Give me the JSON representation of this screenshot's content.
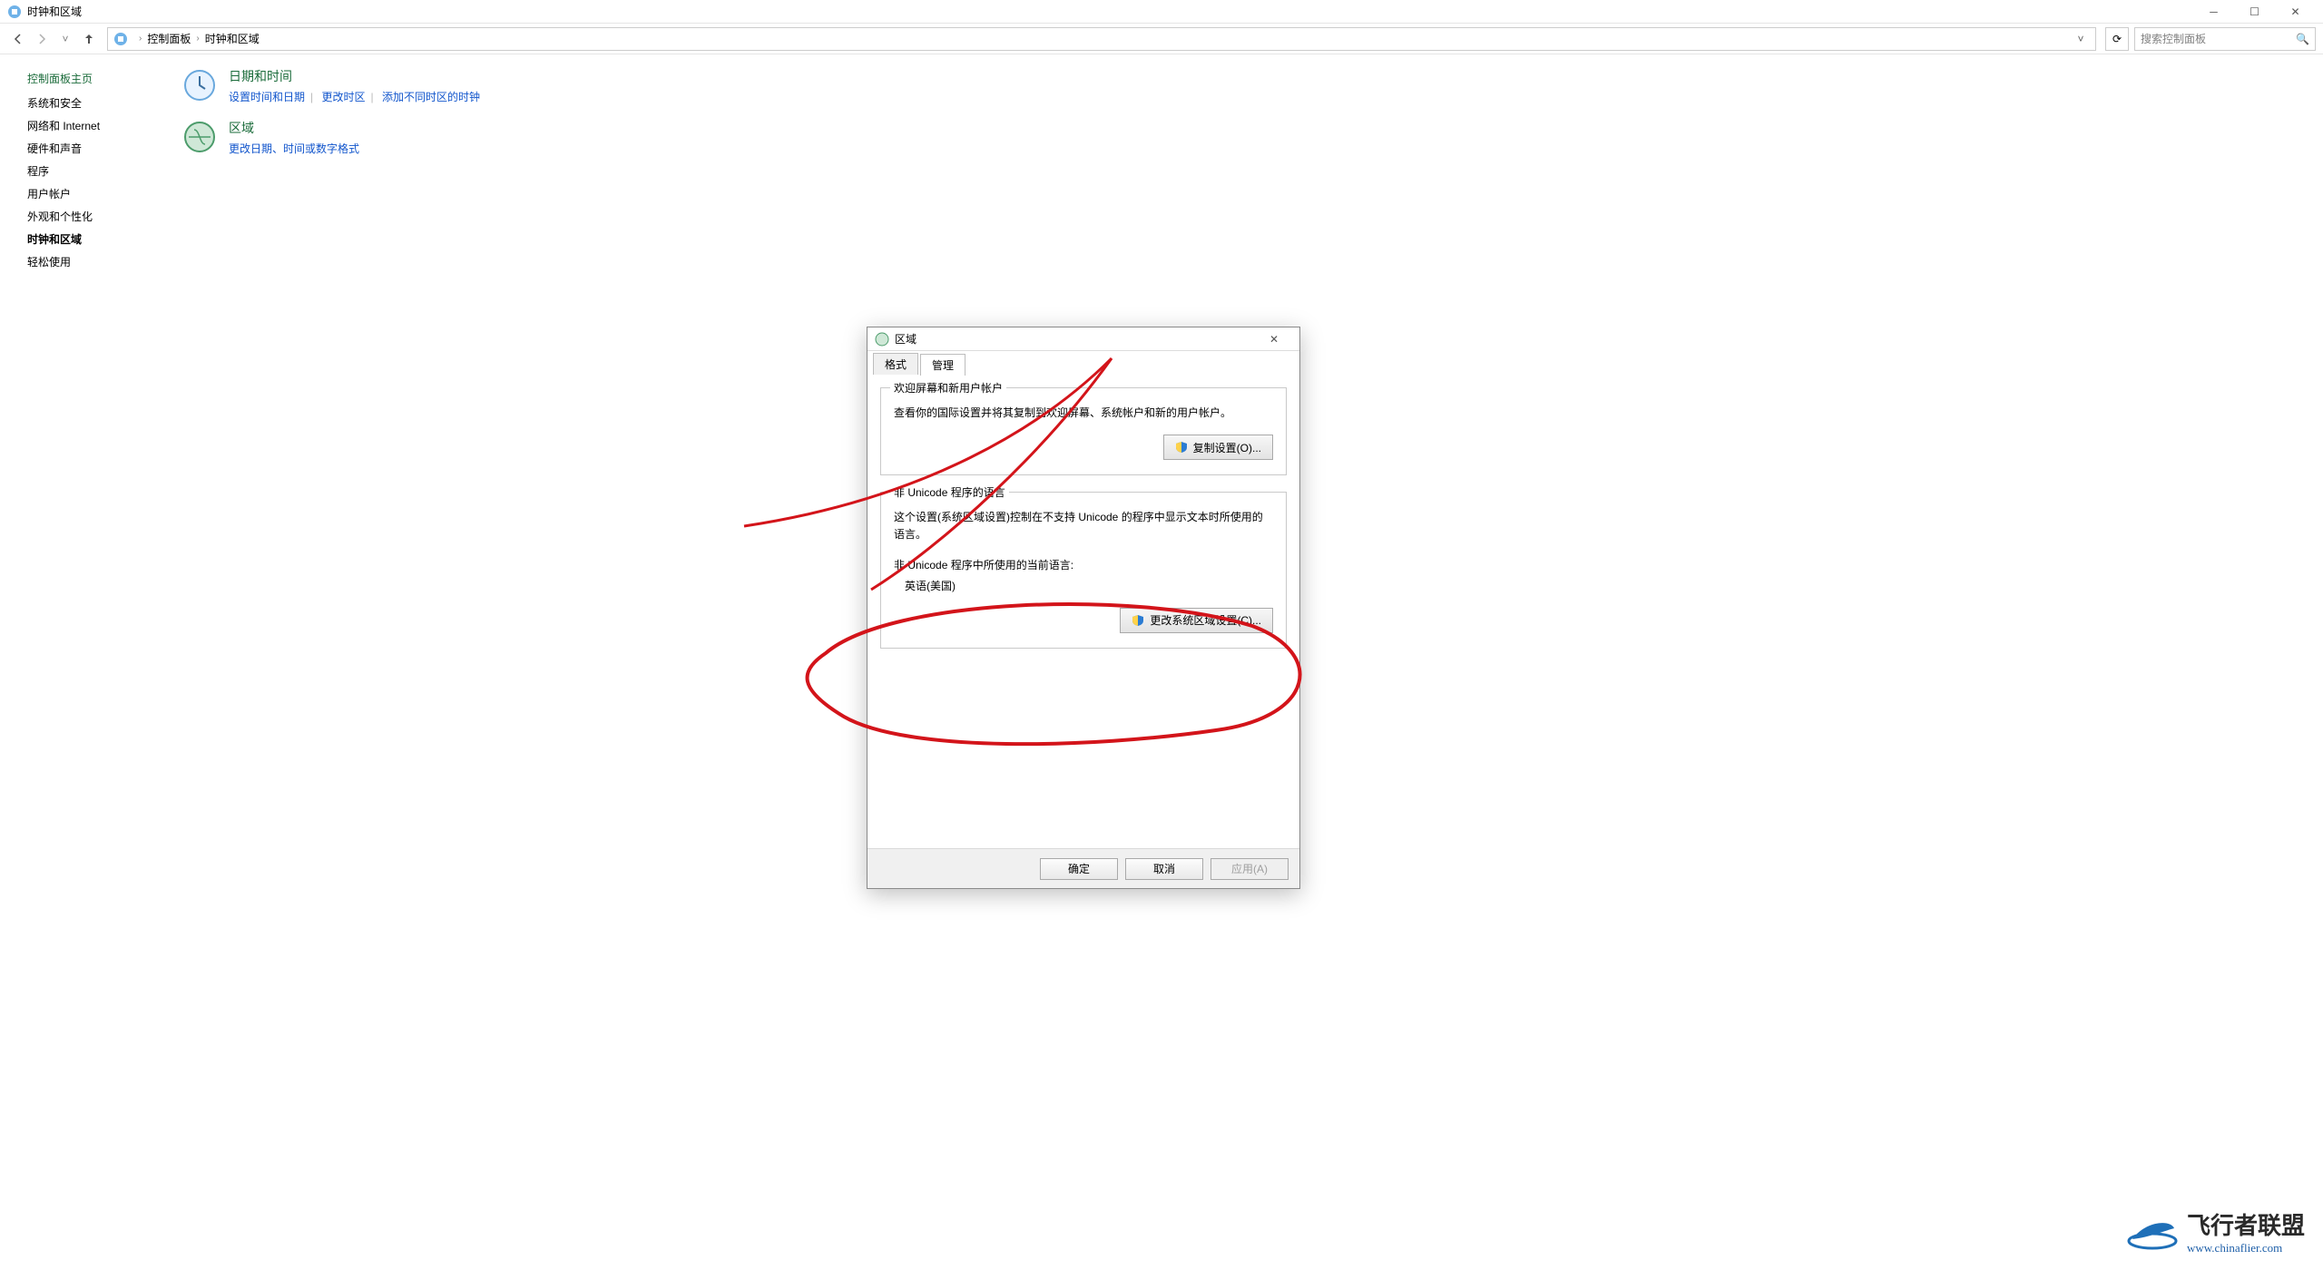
{
  "window": {
    "title": "时钟和区域"
  },
  "window_controls": {
    "min": "─",
    "max": "☐",
    "close": "✕"
  },
  "address": {
    "crumbs": [
      "控制面板",
      "时钟和区域"
    ],
    "dropdown_glyph": "˅",
    "refresh_glyph": "⟳"
  },
  "search": {
    "placeholder": "搜索控制面板",
    "icon_glyph": "🔍"
  },
  "sidebar": {
    "heading": "控制面板主页",
    "items": [
      {
        "label": "系统和安全"
      },
      {
        "label": "网络和 Internet"
      },
      {
        "label": "硬件和声音"
      },
      {
        "label": "程序"
      },
      {
        "label": "用户帐户"
      },
      {
        "label": "外观和个性化"
      },
      {
        "label": "时钟和区域",
        "active": true
      },
      {
        "label": "轻松使用"
      }
    ]
  },
  "categories": [
    {
      "title": "日期和时间",
      "links": [
        "设置时间和日期",
        "更改时区",
        "添加不同时区的时钟"
      ]
    },
    {
      "title": "区域",
      "links": [
        "更改日期、时间或数字格式"
      ]
    }
  ],
  "dialog": {
    "title": "区域",
    "tabs": [
      "格式",
      "管理"
    ],
    "active_tab": 1,
    "group1": {
      "legend": "欢迎屏幕和新用户帐户",
      "desc": "查看你的国际设置并将其复制到欢迎屏幕、系统帐户和新的用户帐户。",
      "button": "复制设置(O)..."
    },
    "group2": {
      "legend": "非 Unicode 程序的语言",
      "desc": "这个设置(系统区域设置)控制在不支持 Unicode 的程序中显示文本时所使用的语言。",
      "current_label": "非 Unicode 程序中所使用的当前语言:",
      "current_value": "英语(美国)",
      "button": "更改系统区域设置(C)..."
    },
    "footer": {
      "ok": "确定",
      "cancel": "取消",
      "apply": "应用(A)"
    }
  },
  "watermark": {
    "line1": "飞行者联盟",
    "line2": "www.chinaflier.com"
  }
}
